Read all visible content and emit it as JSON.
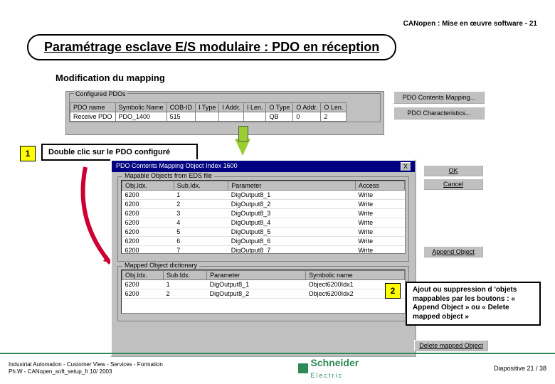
{
  "header": {
    "crumb": "CANopen : Mise en œuvre software -  21"
  },
  "title": "Paramétrage esclave E/S modulaire : PDO en réception",
  "subtitle": "Modification du mapping",
  "configured_pdos": {
    "group_label": "Configured PDOs",
    "headers": [
      "PDO name",
      "Symbolic Name",
      "COB-ID",
      "I Type",
      "I Addr.",
      "I Len.",
      "O Type",
      "O Addr.",
      "O Len."
    ],
    "row": [
      "Receive PDO",
      "PDO_1400",
      "515",
      "",
      "",
      "",
      "QB",
      "0",
      "2"
    ]
  },
  "side_buttons": {
    "mapping": "PDO Contents Mapping...",
    "chars": "PDO Characteristics..."
  },
  "step1_num": "1",
  "step1_text": "Double clic sur le PDO configuré",
  "dialog": {
    "title": "PDO Contents Mapping Object Index 1600",
    "close": "X",
    "grp1_label": "Mapable Objects from EDS file",
    "list1_headers": [
      "Obj.Idx.",
      "Sub.Idx.",
      "Parameter",
      "Access"
    ],
    "list1_rows": [
      [
        "6200",
        "1",
        "DigOutput8_1",
        "Write"
      ],
      [
        "6200",
        "2",
        "DigOutput8_2",
        "Write"
      ],
      [
        "6200",
        "3",
        "DigOutput8_3",
        "Write"
      ],
      [
        "6200",
        "4",
        "DigOutput8_4",
        "Write"
      ],
      [
        "6200",
        "5",
        "DigOutput8_5",
        "Write"
      ],
      [
        "6200",
        "6",
        "DigOutput8_6",
        "Write"
      ],
      [
        "6200",
        "7",
        "DigOutput8_7",
        "Write"
      ]
    ],
    "grp2_label": "Mapped Object dictionary",
    "list2_headers": [
      "Obj.Idx.",
      "Sub.Idx.",
      "Parameter",
      "Symbolic name"
    ],
    "list2_rows": [
      [
        "6200",
        "1",
        "DigOutput8_1",
        "Object6200Idx1"
      ],
      [
        "6200",
        "2",
        "DigOutput8_2",
        "Object6200Idx2"
      ]
    ],
    "ok": "OK",
    "cancel": "Cancel",
    "append": "Append Object",
    "delete": "Delete mapped Object"
  },
  "step2_num": "2",
  "step2_text": "Ajout ou suppression d 'objets mappables par les boutons : « Append Object » ou « Delete mapped object »",
  "footer": {
    "line1": "Industrial Automation -  Customer View -  Services -  Formation",
    "line2": "Ph.W -  CANopen_soft_setup_fr  10/ 2003",
    "logo": "Schneider",
    "logo2": "Electric",
    "slide": "Diapositive 21 / 38"
  }
}
